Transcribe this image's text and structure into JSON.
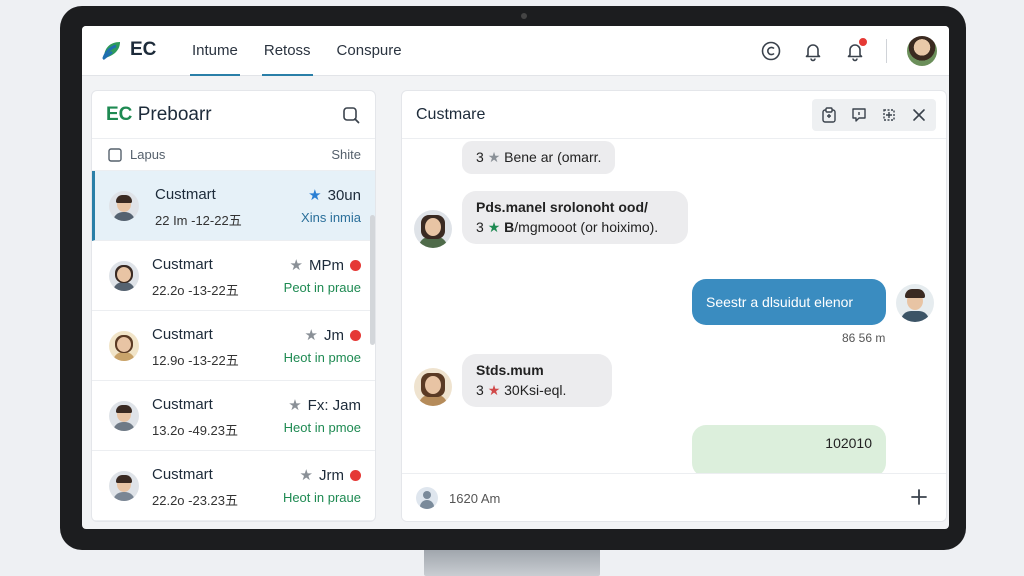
{
  "app": {
    "logo_text": "EC",
    "tabs": [
      {
        "label": "Intume",
        "active": true
      },
      {
        "label": "Retoss",
        "active": true
      },
      {
        "label": "Conspure",
        "active": false
      }
    ]
  },
  "left_panel": {
    "title_brand": "EC",
    "title_rest": "Preboarr",
    "filter_label": "Lapus",
    "filter_right": "Shite",
    "items": [
      {
        "name": "Custmart",
        "date": "22 Im -12-22五",
        "meta": "30un",
        "sub": "Xins inmia",
        "star": "blue",
        "dot": false,
        "active": true
      },
      {
        "name": "Custmart",
        "date": "22.2o -13-22五",
        "meta": "MPm",
        "sub": "Peot in praue",
        "star": "gray",
        "dot": true,
        "active": false
      },
      {
        "name": "Custmart",
        "date": "12.9o -13-22五",
        "meta": "Jm",
        "sub": "Heot in pmoe",
        "star": "gray",
        "dot": true,
        "active": false
      },
      {
        "name": "Custmart",
        "date": "13.2o -49.23五",
        "meta": "Fx: Jam",
        "sub": "Heot in pmoe",
        "star": "gray",
        "dot": false,
        "active": false
      },
      {
        "name": "Custmart",
        "date": "22.2o -23.23五",
        "meta": "Jrm",
        "sub": "Heot in praue",
        "star": "gray",
        "dot": true,
        "active": false
      }
    ]
  },
  "chat": {
    "title": "Custmare",
    "messages": [
      {
        "num": "3",
        "text": "Bene ar (omarr."
      },
      {
        "line1": "Pds.manel srolonoht ood/",
        "num": "3",
        "bold": "B",
        "line2": "/mgmooot (or hoiximo)."
      },
      {
        "text": "Seestr a dlsuidut elenor",
        "time": "86 56 m"
      },
      {
        "line1": "Stds.mum",
        "num": "3",
        "line2": "30Ksi-eql."
      },
      {
        "text": "102010"
      }
    ],
    "footer_time": "1620 Am"
  },
  "colors": {
    "accent": "#2a7fa8",
    "brand_green": "#1e8a52",
    "out_bubble": "#3a8cc0",
    "notification": "#e53935"
  }
}
